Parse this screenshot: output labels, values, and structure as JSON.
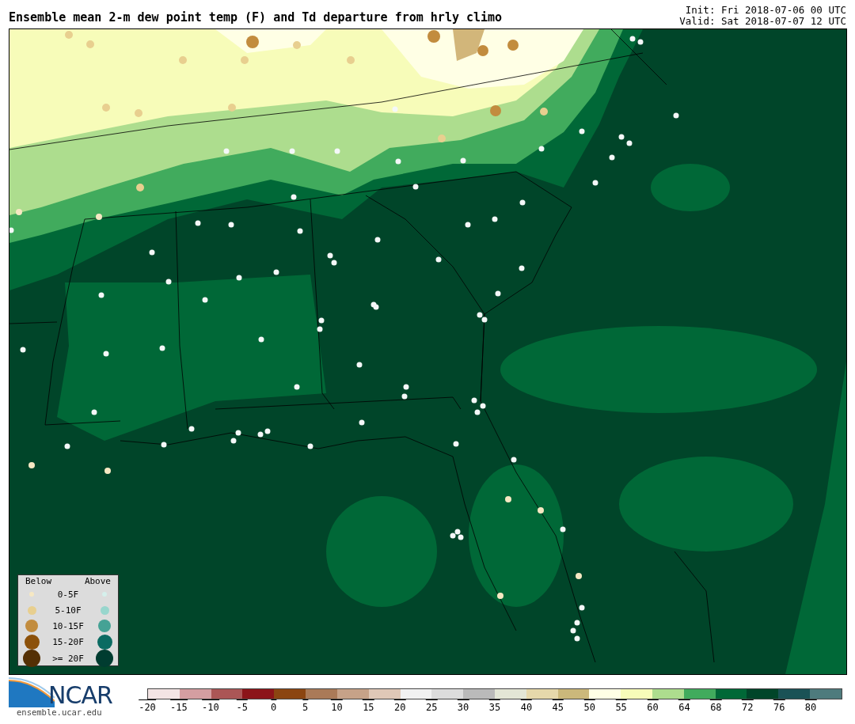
{
  "title": "Ensemble mean 2-m dew point temp (F) and Td departure from hrly climo",
  "init": "Init: Fri 2018-07-06 00 UTC",
  "valid": "Valid: Sat 2018-07-07 12 UTC",
  "legend": {
    "below_header": "Below",
    "above_header": "Above",
    "rows": [
      {
        "label": "0-5F",
        "below": {
          "color": "#f6e8c3"
        },
        "above": {
          "color": "#d5f0ec"
        }
      },
      {
        "label": "5-10F",
        "below": {
          "color": "#e8cf8f"
        },
        "above": {
          "color": "#98d6cd"
        }
      },
      {
        "label": "10-15F",
        "below": {
          "color": "#c28c3e"
        },
        "above": {
          "color": "#45a295"
        }
      },
      {
        "label": "15-20F",
        "below": {
          "color": "#8c510a"
        },
        "above": {
          "color": "#0b6b62"
        }
      },
      {
        "label": ">= 20F",
        "below": {
          "color": "#543005"
        },
        "above": {
          "color": "#003c30"
        }
      }
    ]
  },
  "logo": {
    "text": "NCAR",
    "url": "ensemble.ucar.edu"
  },
  "colorbar": {
    "segments": [
      {
        "color": "#f3e4e4"
      },
      {
        "color": "#d49ea1"
      },
      {
        "color": "#ab5656"
      },
      {
        "color": "#8c1419"
      },
      {
        "color": "#8b4511"
      },
      {
        "color": "#aa7a58"
      },
      {
        "color": "#c6a288"
      },
      {
        "color": "#dfc8b7"
      },
      {
        "color": "#f1f1f1"
      },
      {
        "color": "#dcdcdc"
      },
      {
        "color": "#bababa"
      },
      {
        "color": "#e3e6d6"
      },
      {
        "color": "#e6d8ab"
      },
      {
        "color": "#cbb87b"
      },
      {
        "color": "#ffffe5"
      },
      {
        "color": "#f7fcb9"
      },
      {
        "color": "#addd8e"
      },
      {
        "color": "#41ab5d"
      },
      {
        "color": "#006837"
      },
      {
        "color": "#004529"
      },
      {
        "color": "#1a5256"
      },
      {
        "color": "#4e7b7d"
      }
    ],
    "ticks": [
      "-20",
      "-15",
      "-10",
      "-5",
      "0",
      "5",
      "10",
      "15",
      "20",
      "25",
      "30",
      "35",
      "40",
      "45",
      "50",
      "55",
      "60",
      "64",
      "68",
      "72",
      "76",
      "80"
    ]
  }
}
